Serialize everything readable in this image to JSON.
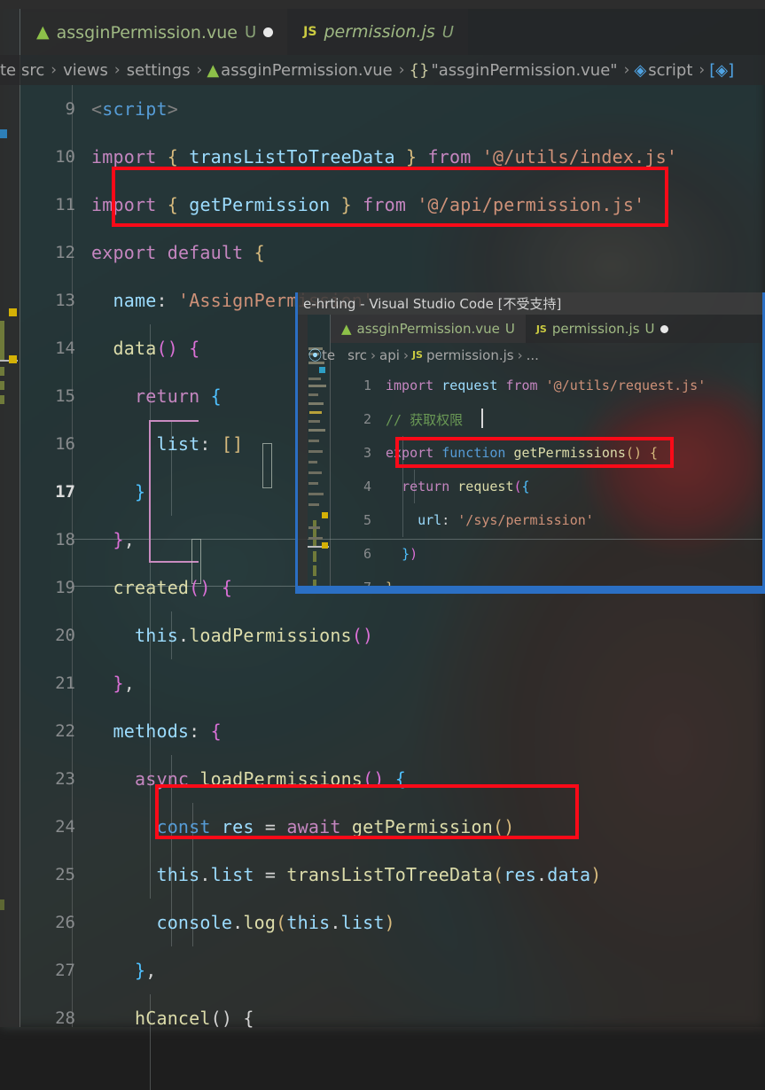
{
  "outer_window": {
    "tabs": [
      {
        "icon": "vue-file-icon",
        "label": "assginPermission.vue",
        "status": "U",
        "dirty": true,
        "active": true
      },
      {
        "icon": "js-file-icon",
        "label": "permission.js",
        "status": "U",
        "dirty": false,
        "active": false
      }
    ],
    "breadcrumb": {
      "truncated_prefix": "te",
      "items": [
        "src",
        "views",
        "settings",
        "assginPermission.vue",
        "\"assginPermission.vue\"",
        "script",
        ""
      ],
      "separator": "›",
      "brace_icon": "{}",
      "cube_icon": "cube-icon",
      "script_icon": "script-bracket-icon"
    },
    "code_lines": [
      {
        "n": "9",
        "indent": 0
      },
      {
        "n": "10",
        "indent": 0
      },
      {
        "n": "11",
        "indent": 0
      },
      {
        "n": "12",
        "indent": 0
      },
      {
        "n": "13",
        "indent": 1
      },
      {
        "n": "14",
        "indent": 1
      },
      {
        "n": "15",
        "indent": 2
      },
      {
        "n": "16",
        "indent": 3
      },
      {
        "n": "17",
        "indent": 2,
        "active": true
      },
      {
        "n": "18",
        "indent": 1
      },
      {
        "n": "19",
        "indent": 1
      },
      {
        "n": "20",
        "indent": 2
      },
      {
        "n": "21",
        "indent": 1
      },
      {
        "n": "22",
        "indent": 1
      },
      {
        "n": "23",
        "indent": 2
      },
      {
        "n": "24",
        "indent": 3
      },
      {
        "n": "25",
        "indent": 3
      },
      {
        "n": "26",
        "indent": 3
      },
      {
        "n": "27",
        "indent": 2
      },
      {
        "n": "28",
        "indent": 2
      }
    ],
    "code_text": {
      "l9_tag_open": "<",
      "l9_tag_name": "script",
      "l9_tag_close": ">",
      "l10_import": "import",
      "l10_lbrace": "{",
      "l10_binding": "transListToTreeData",
      "l10_rbrace": "}",
      "l10_from": "from",
      "l10_source": "'@/utils/index.js'",
      "l11_import": "import",
      "l11_lbrace": "{",
      "l11_binding": "getPermission",
      "l11_rbrace": "}",
      "l11_from": "from",
      "l11_source": "'@/api/permission.js'",
      "l12_export": "export",
      "l12_default": "default",
      "l12_lbrace": "{",
      "l13_key": "name",
      "l13_colon": ":",
      "l13_value": "'AssignPermission'",
      "l13_comma": ",",
      "l14_fn": "data",
      "l14_parens": "()",
      "l14_lbrace": "{",
      "l15_return": "return",
      "l15_lbrace": "{",
      "l16_key": "list",
      "l16_colon": ":",
      "l16_value": "[]",
      "l17_rbrace": "}",
      "l18_rbrace": "}",
      "l18_comma": ",",
      "l19_fn": "created",
      "l19_parens": "()",
      "l19_lbrace": "{",
      "l20_this": "this",
      "l20_dot": ".",
      "l20_call": "loadPermissions",
      "l20_parens": "()",
      "l21_rbrace": "}",
      "l21_comma": ",",
      "l22_key": "methods",
      "l22_colon": ":",
      "l22_lbrace": "{",
      "l23_async": "async",
      "l23_fn": "loadPermissions",
      "l23_parens": "()",
      "l23_lbrace": "{",
      "l24_const": "const",
      "l24_var": "res",
      "l24_eq": "=",
      "l24_await": "await",
      "l24_call": "getPermission",
      "l24_parens": "()",
      "l25_this": "this",
      "l25_dot1": ".",
      "l25_list": "list",
      "l25_eq": "=",
      "l25_call": "transListToTreeData",
      "l25_lparen": "(",
      "l25_arg1": "res",
      "l25_dot2": ".",
      "l25_arg2": "data",
      "l25_rparen": ")",
      "l26_console": "console",
      "l26_dot1": ".",
      "l26_log": "log",
      "l26_lparen": "(",
      "l26_this": "this",
      "l26_dot2": ".",
      "l26_list": "list",
      "l26_rparen": ")",
      "l27_rbrace": "}",
      "l27_comma": ",",
      "l28_fn": "hCancel",
      "l28_parens": "()",
      "l28_lbrace": "{"
    }
  },
  "inner_window": {
    "title": "e-hrting - Visual Studio Code [不受支持]",
    "tabs": [
      {
        "icon": "vue-file-icon",
        "label": "assginPermission.vue",
        "status": "U",
        "dirty": false,
        "active": true
      },
      {
        "icon": "js-file-icon",
        "label": "permission.js",
        "status": "U",
        "dirty": true,
        "active": false
      }
    ],
    "breadcrumb": {
      "truncated_prefix": "te",
      "items": [
        "src",
        "api",
        "permission.js",
        "..."
      ],
      "separator": "›",
      "js_icon": "js-file-icon"
    },
    "code_lines": [
      {
        "n": "1"
      },
      {
        "n": "2"
      },
      {
        "n": "3"
      },
      {
        "n": "4"
      },
      {
        "n": "5"
      },
      {
        "n": "6"
      },
      {
        "n": "7"
      }
    ],
    "code_text": {
      "l1_import": "import",
      "l1_binding": "request",
      "l1_from": "from",
      "l1_source": "'@/utils/request.js'",
      "l2_comment": "// 获取权限",
      "l3_export": "export",
      "l3_function": "function",
      "l3_fn": "getPermissions",
      "l3_parens": "()",
      "l3_lbrace": "{",
      "l4_return": "return",
      "l4_call": "request",
      "l4_lparen": "(",
      "l4_lbrace": "{",
      "l5_key": "url",
      "l5_colon": ":",
      "l5_value": "'/sys/permission'",
      "l6_rbrace": "}",
      "l6_rparen": ")",
      "l7_rbrace": "}"
    }
  },
  "annotations": {
    "highlight_boxes": [
      {
        "name": "import-getPermission-highlight",
        "line": "11"
      },
      {
        "name": "export-function-getPermissions-highlight",
        "line": "3"
      },
      {
        "name": "const-res-await-highlight",
        "line": "24"
      }
    ],
    "color": "#fa0a18"
  },
  "colors": {
    "accent_blue": "#2b6fc4",
    "annotation_red": "#fa0a18",
    "vue_green": "#8dc149",
    "js_yellow": "#cbcb41",
    "tab_text": "#9fb983",
    "line_number": "#888b8d",
    "keyword_purple": "#c586c0",
    "keyword_blue": "#569cd6",
    "string_orange": "#ce9178",
    "function_yellow": "#dcdcaa",
    "variable_lightblue": "#9cdcfe",
    "comment_green": "#6a9955"
  }
}
